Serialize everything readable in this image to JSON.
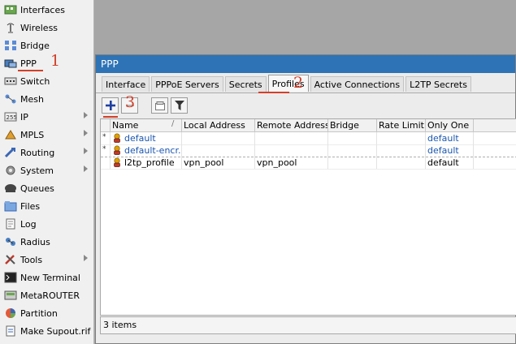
{
  "sidebar": {
    "items": [
      {
        "label": "Interfaces",
        "icon": "interfaces-icon",
        "submenu": false
      },
      {
        "label": "Wireless",
        "icon": "wireless-icon",
        "submenu": false
      },
      {
        "label": "Bridge",
        "icon": "bridge-icon",
        "submenu": false
      },
      {
        "label": "PPP",
        "icon": "ppp-icon",
        "submenu": false
      },
      {
        "label": "Switch",
        "icon": "switch-icon",
        "submenu": false
      },
      {
        "label": "Mesh",
        "icon": "mesh-icon",
        "submenu": false
      },
      {
        "label": "IP",
        "icon": "ip-icon",
        "submenu": true
      },
      {
        "label": "MPLS",
        "icon": "mpls-icon",
        "submenu": true
      },
      {
        "label": "Routing",
        "icon": "routing-icon",
        "submenu": true
      },
      {
        "label": "System",
        "icon": "system-icon",
        "submenu": true
      },
      {
        "label": "Queues",
        "icon": "queues-icon",
        "submenu": false
      },
      {
        "label": "Files",
        "icon": "files-icon",
        "submenu": false
      },
      {
        "label": "Log",
        "icon": "log-icon",
        "submenu": false
      },
      {
        "label": "Radius",
        "icon": "radius-icon",
        "submenu": false
      },
      {
        "label": "Tools",
        "icon": "tools-icon",
        "submenu": true
      },
      {
        "label": "New Terminal",
        "icon": "terminal-icon",
        "submenu": false
      },
      {
        "label": "MetaROUTER",
        "icon": "metarouter-icon",
        "submenu": false
      },
      {
        "label": "Partition",
        "icon": "partition-icon",
        "submenu": false
      },
      {
        "label": "Make Supout.rif",
        "icon": "supout-icon",
        "submenu": false
      }
    ]
  },
  "window": {
    "title": "PPP",
    "tabs": [
      {
        "label": "Interface",
        "active": false
      },
      {
        "label": "PPPoE Servers",
        "active": false
      },
      {
        "label": "Secrets",
        "active": false
      },
      {
        "label": "Profiles",
        "active": true
      },
      {
        "label": "Active Connections",
        "active": false
      },
      {
        "label": "L2TP Secrets",
        "active": false
      }
    ],
    "toolbar": [
      "add-icon",
      "remove-icon",
      "copy-icon",
      "filter-icon"
    ],
    "table": {
      "columns": [
        "Name",
        "Local Address",
        "Remote Address",
        "Bridge",
        "Rate Limit...",
        "Only One"
      ],
      "sort_indicator": "/",
      "rows": [
        {
          "marker": "*",
          "cells": [
            "default",
            "",
            "",
            "",
            "",
            "default"
          ],
          "style": "default"
        },
        {
          "marker": "*",
          "cells": [
            "default-encr...",
            "",
            "",
            "",
            "",
            "default"
          ],
          "style": "default"
        },
        {
          "marker": "",
          "cells": [
            "l2tp_profile",
            "vpn_pool",
            "vpn_pool",
            "",
            "",
            "default"
          ],
          "style": "normal"
        }
      ]
    },
    "status": "3 items"
  },
  "annotations": {
    "step1": "1",
    "step2": "2",
    "step3": "3",
    "color": "#d2402a"
  },
  "colors": {
    "titlebar": "#2d73b6",
    "default_text": "#1a56b0"
  }
}
